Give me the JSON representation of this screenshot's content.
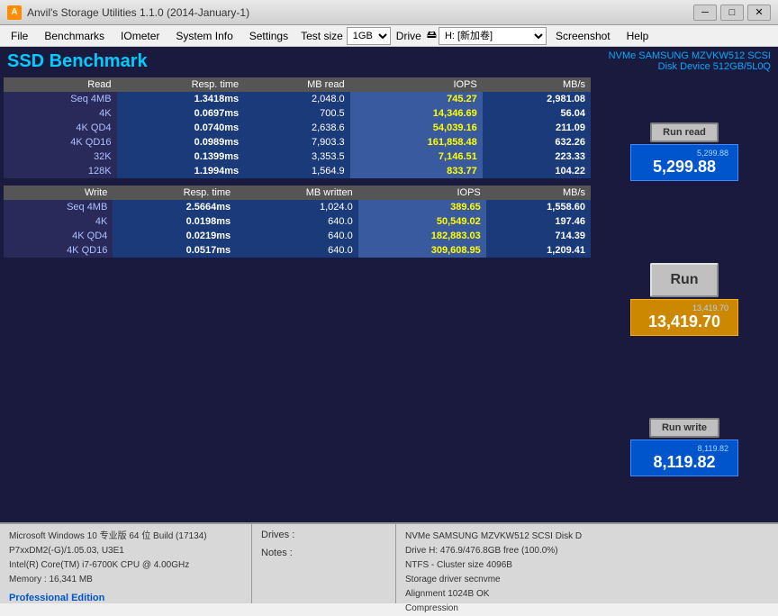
{
  "window": {
    "title": "Anvil's Storage Utilities 1.1.0 (2014-January-1)",
    "icon": "A"
  },
  "menu": {
    "items": [
      "File",
      "Benchmarks",
      "IOmeter",
      "System Info",
      "Settings"
    ],
    "test_size_label": "Test size",
    "test_size_value": "1GB",
    "drive_label": "Drive",
    "drive_value": "H: [新加卷]",
    "screenshot_label": "Screenshot",
    "help_label": "Help"
  },
  "header": {
    "title": "SSD Benchmark",
    "device_line1": "NVMe SAMSUNG MZVKW512 SCSI",
    "device_line2": "Disk Device 512GB/5L0Q"
  },
  "read_table": {
    "headers": [
      "Read",
      "Resp. time",
      "MB read",
      "IOPS",
      "MB/s"
    ],
    "rows": [
      [
        "Seq 4MB",
        "1.3418ms",
        "2,048.0",
        "745.27",
        "2,981.08"
      ],
      [
        "4K",
        "0.0697ms",
        "700.5",
        "14,346.69",
        "56.04"
      ],
      [
        "4K QD4",
        "0.0740ms",
        "2,638.6",
        "54,039.16",
        "211.09"
      ],
      [
        "4K QD16",
        "0.0989ms",
        "7,903.3",
        "161,858.48",
        "632.26"
      ],
      [
        "32K",
        "0.1399ms",
        "3,353.5",
        "7,146.51",
        "223.33"
      ],
      [
        "128K",
        "1.1994ms",
        "1,564.9",
        "833.77",
        "104.22"
      ]
    ]
  },
  "write_table": {
    "headers": [
      "Write",
      "Resp. time",
      "MB written",
      "IOPS",
      "MB/s"
    ],
    "rows": [
      [
        "Seq 4MB",
        "2.5664ms",
        "1,024.0",
        "389.65",
        "1,558.60"
      ],
      [
        "4K",
        "0.0198ms",
        "640.0",
        "50,549.02",
        "197.46"
      ],
      [
        "4K QD4",
        "0.0219ms",
        "640.0",
        "182,883.03",
        "714.39"
      ],
      [
        "4K QD16",
        "0.0517ms",
        "640.0",
        "309,608.95",
        "1,209.41"
      ]
    ]
  },
  "scores": {
    "read_small": "5,299.88",
    "read_large": "5,299.88",
    "run_small": "13,419.70",
    "run_large": "13,419.70",
    "write_small": "8,119.82",
    "write_large": "8,119.82",
    "run_read_label": "Run read",
    "run_main_label": "Run",
    "run_write_label": "Run write"
  },
  "status": {
    "sys_line1": "Microsoft Windows 10 专业版 64 位 Build (17134)",
    "sys_line2": "P7xxDM2(-G)/1.05.03, U3E1",
    "sys_line3": "Intel(R) Core(TM) i7-6700K CPU @ 4.00GHz",
    "sys_line4": "Memory : 16,341 MB",
    "professional": "Professional Edition",
    "drives_label": "Drives :",
    "notes_label": "Notes :",
    "drive_info_line1": "NVMe SAMSUNG MZVKW512 SCSI Disk D",
    "drive_info_line2": "Drive H: 476.9/476.8GB free (100.0%)",
    "drive_info_line3": "NTFS - Cluster size 4096B",
    "drive_info_line4": "Storage driver  secnvme",
    "drive_info_line5": "",
    "drive_info_line6": "Alignment 1024B OK",
    "drive_info_line7": "Compression"
  }
}
